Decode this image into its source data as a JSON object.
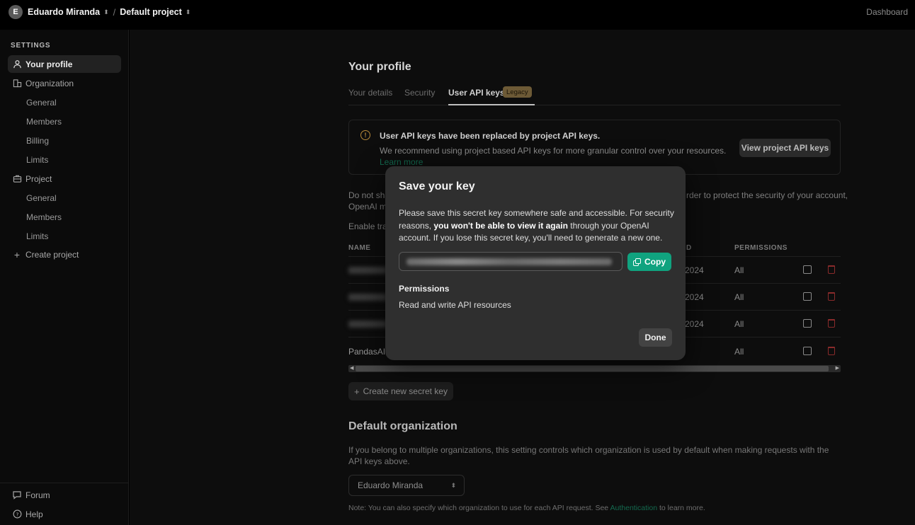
{
  "topbar": {
    "avatar_letter": "E",
    "user_name": "Eduardo Miranda",
    "separator": "/",
    "project_name": "Default project",
    "dashboard_link": "Dashboard"
  },
  "sidebar": {
    "heading": "SETTINGS",
    "your_profile": "Your profile",
    "organization": "Organization",
    "org_items": [
      "General",
      "Members",
      "Billing",
      "Limits"
    ],
    "project": "Project",
    "project_items": [
      "General",
      "Members",
      "Limits"
    ],
    "create_project": "Create project",
    "forum": "Forum",
    "help": "Help"
  },
  "profile": {
    "title": "Your profile",
    "tabs": [
      "Your details",
      "Security",
      "User API keys"
    ],
    "legacy_badge": "Legacy"
  },
  "notice": {
    "title": "User API keys have been replaced by project API keys.",
    "text": "We recommend using project based API keys for more granular control over your resources.",
    "link_text": "Learn more",
    "button": "View project API keys"
  },
  "background": {
    "warn_left": "Do not sha",
    "warn_right": "rder to protect the security of your account,",
    "warn_line2": "OpenAI m",
    "enable_text": "Enable tra",
    "col_name": "NAME",
    "col_mid": "D",
    "col_permissions": "PERMISSIONS",
    "rows": [
      {
        "date": "2024",
        "perm": "All"
      },
      {
        "date": "2024",
        "perm": "All"
      },
      {
        "date": "2024",
        "perm": "All"
      },
      {
        "name": "PandasAI",
        "perm": "All"
      }
    ],
    "create_key_button": "Create new secret key"
  },
  "default_org": {
    "title": "Default organization",
    "description": "If you belong to multiple organizations, this setting controls which organization is used by default when making requests with the API keys above.",
    "selected": "Eduardo Miranda",
    "note_prefix": "Note: You can also specify which organization to use for each API request. See",
    "note_link": "Authentication",
    "note_suffix": "to learn more."
  },
  "modal": {
    "title": "Save your key",
    "text_1": "Please save this secret key somewhere safe and accessible. For security reasons,",
    "text_bold": "you won't be able to view it again",
    "text_2": "through your OpenAI account. If you lose this secret key, you'll need to generate a new one.",
    "copy_button": "Copy",
    "permissions_title": "Permissions",
    "permissions_value": "Read and write API resources",
    "done_button": "Done"
  },
  "colors": {
    "accent": "#10a37f",
    "link": "#136a4f",
    "legacy_badge": "#6d5a36",
    "delete_red": "#8a2b2b"
  }
}
